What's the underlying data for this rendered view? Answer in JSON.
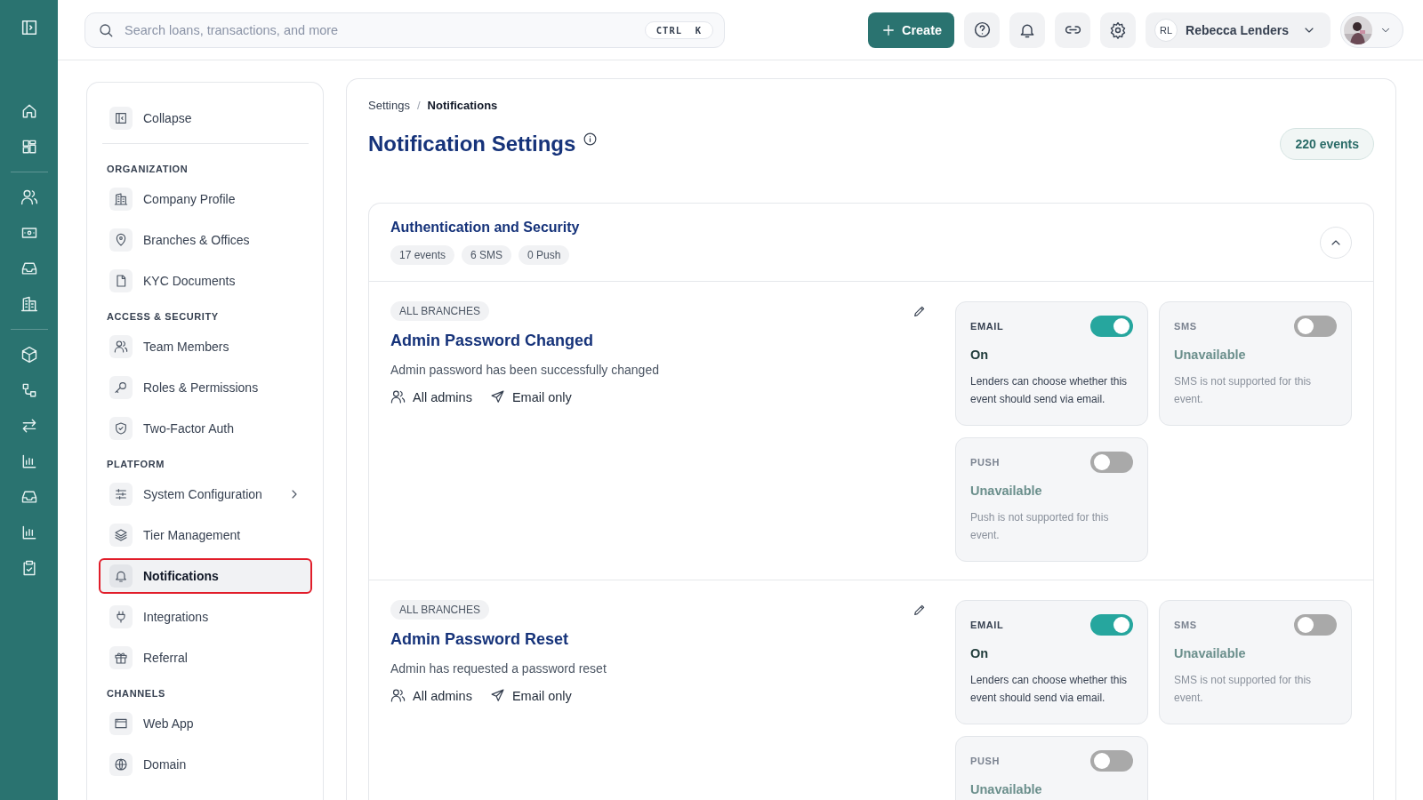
{
  "search": {
    "placeholder": "Search loans, transactions, and more",
    "shortcut": "CTRL  K"
  },
  "header": {
    "create_button": "Create",
    "user_initials": "RL",
    "user_name": "Rebecca Lenders"
  },
  "sidebar": {
    "collapse": "Collapse",
    "sections": [
      {
        "heading": "ORGANIZATION",
        "items": [
          {
            "label": "Company Profile",
            "selected": false,
            "kind": "link"
          },
          {
            "label": "Branches & Offices",
            "selected": false,
            "kind": "link"
          },
          {
            "label": "KYC Documents",
            "selected": false,
            "kind": "link"
          }
        ]
      },
      {
        "heading": "ACCESS & SECURITY",
        "items": [
          {
            "label": "Team Members",
            "selected": false,
            "kind": "link"
          },
          {
            "label": "Roles & Permissions",
            "selected": false,
            "kind": "link"
          },
          {
            "label": "Two-Factor Auth",
            "selected": false,
            "kind": "link"
          }
        ]
      },
      {
        "heading": "PLATFORM",
        "items": [
          {
            "label": "System Configuration",
            "selected": false,
            "kind": "submenu"
          },
          {
            "label": "Tier Management",
            "selected": false,
            "kind": "link"
          },
          {
            "label": "Notifications",
            "selected": true,
            "kind": "link"
          },
          {
            "label": "Integrations",
            "selected": false,
            "kind": "link"
          },
          {
            "label": "Referral",
            "selected": false,
            "kind": "link"
          }
        ]
      },
      {
        "heading": "CHANNELS",
        "items": [
          {
            "label": "Web App",
            "selected": false,
            "kind": "link"
          },
          {
            "label": "Domain",
            "selected": false,
            "kind": "link"
          }
        ]
      }
    ]
  },
  "breadcrumb_separator": "/",
  "breadcrumb": [
    {
      "label": "Settings",
      "selected": false
    },
    {
      "label": "Notifications",
      "selected": true
    }
  ],
  "page": {
    "title": "Notification Settings",
    "event_count": "220 events"
  },
  "group": {
    "title": "Authentication and Security",
    "expanded": true,
    "counts": [
      "17 events",
      "6 SMS",
      "0 Push"
    ],
    "events": [
      {
        "scope": "ALL BRANCHES",
        "title": "Admin Password Changed",
        "description": "Admin password has been successfully changed",
        "audience": "All admins",
        "delivery": "Email only",
        "channels": [
          {
            "label": "EMAIL",
            "on": true,
            "available": true,
            "status": "On",
            "description": "Lenders can choose whether this event should send via email."
          },
          {
            "label": "SMS",
            "on": false,
            "available": false,
            "status": "Unavailable",
            "description": "SMS is not supported for this event."
          },
          {
            "label": "PUSH",
            "on": false,
            "available": false,
            "status": "Unavailable",
            "description": "Push is not supported for this event."
          }
        ]
      },
      {
        "scope": "ALL BRANCHES",
        "title": "Admin Password Reset",
        "description": "Admin has requested a password reset",
        "audience": "All admins",
        "delivery": "Email only",
        "channels": [
          {
            "label": "EMAIL",
            "on": true,
            "available": true,
            "status": "On",
            "description": "Lenders can choose whether this event should send via email."
          },
          {
            "label": "SMS",
            "on": false,
            "available": false,
            "status": "Unavailable",
            "description": "SMS is not supported for this event."
          },
          {
            "label": "PUSH",
            "on": false,
            "available": false,
            "status": "Unavailable"
          }
        ]
      }
    ]
  }
}
